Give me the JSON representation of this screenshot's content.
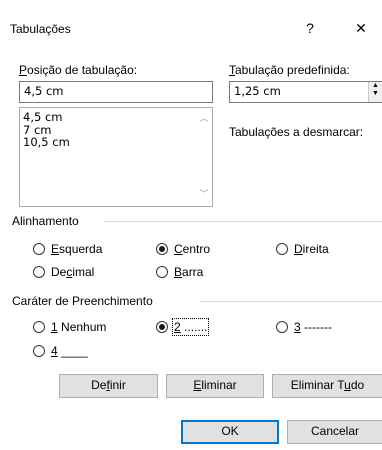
{
  "window": {
    "title": "Tabulações",
    "help_glyph": "?",
    "close_glyph": "✕"
  },
  "tab_position": {
    "label": "Posição de tabulação:",
    "value": "4,5 cm",
    "list": [
      "4,5 cm",
      "7 cm",
      "10,5 cm"
    ]
  },
  "default_stops": {
    "label": "Tabulação predefinida:",
    "value": "1,25 cm"
  },
  "clear_label": "Tabulações a desmarcar:",
  "alignment": {
    "legend": "Alinhamento",
    "options": [
      "Esquerda",
      "Centro",
      "Direita",
      "Decimal",
      "Barra"
    ],
    "selected": "Centro"
  },
  "leader": {
    "legend": "Caráter de Preenchimento",
    "options": [
      "1 Nenhum",
      "2 .......",
      "3 -------",
      "4 ____"
    ],
    "selected": "2 ......."
  },
  "buttons": {
    "set": "Definir",
    "clear": "Eliminar",
    "clear_all": "Eliminar Tudo",
    "ok": "OK",
    "cancel": "Cancelar"
  },
  "colors": {
    "accent": "#0078d7",
    "button_face": "#e1e1e1"
  }
}
